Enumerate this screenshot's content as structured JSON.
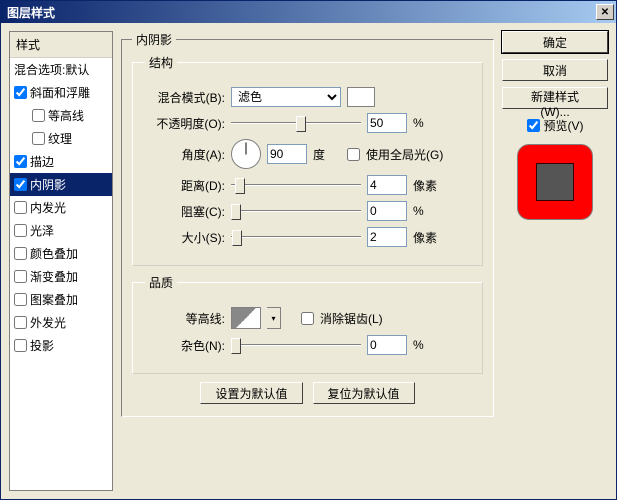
{
  "window": {
    "title": "图层样式"
  },
  "sidebar": {
    "header": "样式",
    "blend": "混合选项:默认",
    "items": [
      {
        "label": "斜面和浮雕",
        "checked": true,
        "sub": [
          {
            "label": "等高线",
            "checked": false
          },
          {
            "label": "纹理",
            "checked": false
          }
        ]
      },
      {
        "label": "描边",
        "checked": true
      },
      {
        "label": "内阴影",
        "checked": true,
        "selected": true
      },
      {
        "label": "内发光",
        "checked": false
      },
      {
        "label": "光泽",
        "checked": false
      },
      {
        "label": "颜色叠加",
        "checked": false
      },
      {
        "label": "渐变叠加",
        "checked": false
      },
      {
        "label": "图案叠加",
        "checked": false
      },
      {
        "label": "外发光",
        "checked": false
      },
      {
        "label": "投影",
        "checked": false
      }
    ]
  },
  "panel": {
    "title": "内阴影",
    "struct": {
      "legend": "结构",
      "blend_label": "混合模式(B):",
      "blend_value": "滤色",
      "opacity_label": "不透明度(O):",
      "opacity_value": "50",
      "opacity_unit": "%",
      "angle_label": "角度(A):",
      "angle_value": "90",
      "angle_unit": "度",
      "global_label": "使用全局光(G)",
      "global_checked": false,
      "distance_label": "距离(D):",
      "distance_value": "4",
      "distance_unit": "像素",
      "choke_label": "阻塞(C):",
      "choke_value": "0",
      "choke_unit": "%",
      "size_label": "大小(S):",
      "size_value": "2",
      "size_unit": "像素"
    },
    "quality": {
      "legend": "品质",
      "contour_label": "等高线:",
      "aa_label": "消除锯齿(L)",
      "aa_checked": false,
      "noise_label": "杂色(N):",
      "noise_value": "0",
      "noise_unit": "%"
    },
    "defaults": {
      "set": "设置为默认值",
      "reset": "复位为默认值"
    }
  },
  "buttons": {
    "ok": "确定",
    "cancel": "取消",
    "newstyle": "新建样式(W)...",
    "preview": "预览(V)",
    "preview_checked": true
  }
}
